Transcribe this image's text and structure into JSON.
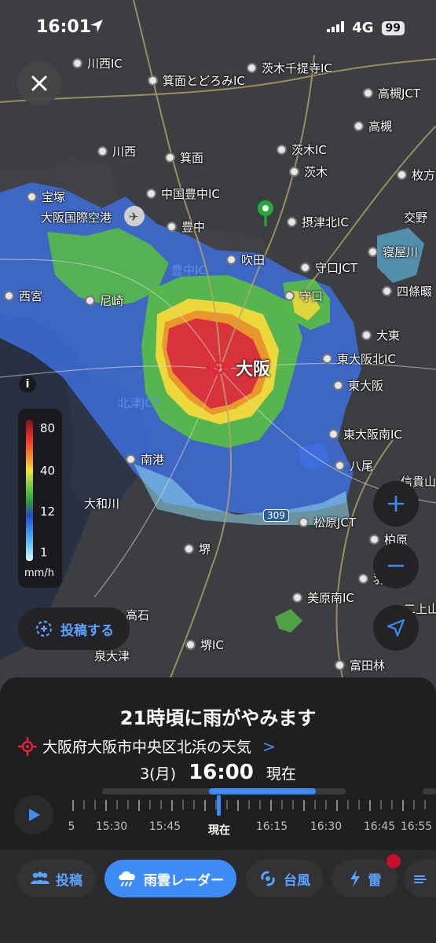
{
  "status": {
    "time": "16:01",
    "network": "4G",
    "battery": "99"
  },
  "map": {
    "labels": [
      {
        "id": "kawanishi-ic",
        "text": "川西IC"
      },
      {
        "id": "mino-ic",
        "text": "箕面とどろみIC"
      },
      {
        "id": "ibaraki-senri",
        "text": "茨木千提寺IC"
      },
      {
        "id": "takatsuki-jct",
        "text": "高槻JCT"
      },
      {
        "id": "takatsuki",
        "text": "高槻"
      },
      {
        "id": "kawanishi",
        "text": "川西"
      },
      {
        "id": "mino",
        "text": "箕面"
      },
      {
        "id": "ibaraki-ic",
        "text": "茨木IC"
      },
      {
        "id": "ibaraki",
        "text": "茨木"
      },
      {
        "id": "hirakata",
        "text": "枚方"
      },
      {
        "id": "takarazuka",
        "text": "宝塚"
      },
      {
        "id": "chugoku-toyonaka",
        "text": "中国豊中IC"
      },
      {
        "id": "itami-airport",
        "text": "大阪国際空港"
      },
      {
        "id": "settsu-kita",
        "text": "摂津北IC"
      },
      {
        "id": "katano",
        "text": "交野"
      },
      {
        "id": "toyonaka",
        "text": "豊中"
      },
      {
        "id": "neyagawa",
        "text": "寝屋川"
      },
      {
        "id": "suita",
        "text": "吹田"
      },
      {
        "id": "moriguchi-jct",
        "text": "守口JCT"
      },
      {
        "id": "toyonaka-ic",
        "text": "豊中IC"
      },
      {
        "id": "nishinomiya",
        "text": "西宮"
      },
      {
        "id": "amagasaki",
        "text": "尼崎"
      },
      {
        "id": "moriguchi",
        "text": "守口"
      },
      {
        "id": "shijonawate",
        "text": "四條畷"
      },
      {
        "id": "daito",
        "text": "大東"
      },
      {
        "id": "osaka",
        "text": "大阪"
      },
      {
        "id": "higashiosaka-kita",
        "text": "東大阪北IC"
      },
      {
        "id": "higashiosaka",
        "text": "東大阪"
      },
      {
        "id": "kitatsu-jct",
        "text": "北津JCT"
      },
      {
        "id": "higashiosaka-minami",
        "text": "東大阪南IC"
      },
      {
        "id": "nanko",
        "text": "南港"
      },
      {
        "id": "yao",
        "text": "八尾"
      },
      {
        "id": "shigisan",
        "text": "信貴山"
      },
      {
        "id": "yamatogawa",
        "text": "大和川"
      },
      {
        "id": "route309",
        "text": "309"
      },
      {
        "id": "matsubara-jct",
        "text": "松原JCT"
      },
      {
        "id": "kashiwara",
        "text": "柏原"
      },
      {
        "id": "sakai",
        "text": "堺"
      },
      {
        "id": "habikino",
        "text": "羽曳"
      },
      {
        "id": "mihara-minami",
        "text": "美原南IC"
      },
      {
        "id": "takaishi",
        "text": "高石"
      },
      {
        "id": "sakai-ic",
        "text": "堺IC"
      },
      {
        "id": "izumiotsu",
        "text": "泉大津"
      },
      {
        "id": "tondabayashi",
        "text": "富田林"
      },
      {
        "id": "nijosan",
        "text": "二上山"
      }
    ]
  },
  "legend": {
    "values": [
      "80",
      "40",
      "12",
      "1"
    ],
    "unit": "mm/h"
  },
  "buttons": {
    "post": "投稿する"
  },
  "sheet": {
    "headline": "21時頃に雨がやみます",
    "location": "大阪府大阪市中央区北浜の天気",
    "date": "3(月)",
    "time": "16:00",
    "time_state": "現在",
    "timeline_progress": 0.44,
    "timeline_labels": [
      "5",
      "15:30",
      "15:45",
      "現在",
      "16:15",
      "16:30",
      "16:45",
      "16:55"
    ]
  },
  "tabs": [
    {
      "label": "投稿",
      "icon": "people-icon"
    },
    {
      "label": "雨雲レーダー",
      "icon": "rain-cloud-icon",
      "active": true
    },
    {
      "label": "台風",
      "icon": "typhoon-icon"
    },
    {
      "label": "雷",
      "icon": "lightning-icon"
    }
  ],
  "colors": {
    "accent": "#3d8cf5",
    "heavy_rain": "#d8323c",
    "moderate_rain": "#f1e43c",
    "light_rain": "#58c24a",
    "notice": "#c8102e"
  }
}
